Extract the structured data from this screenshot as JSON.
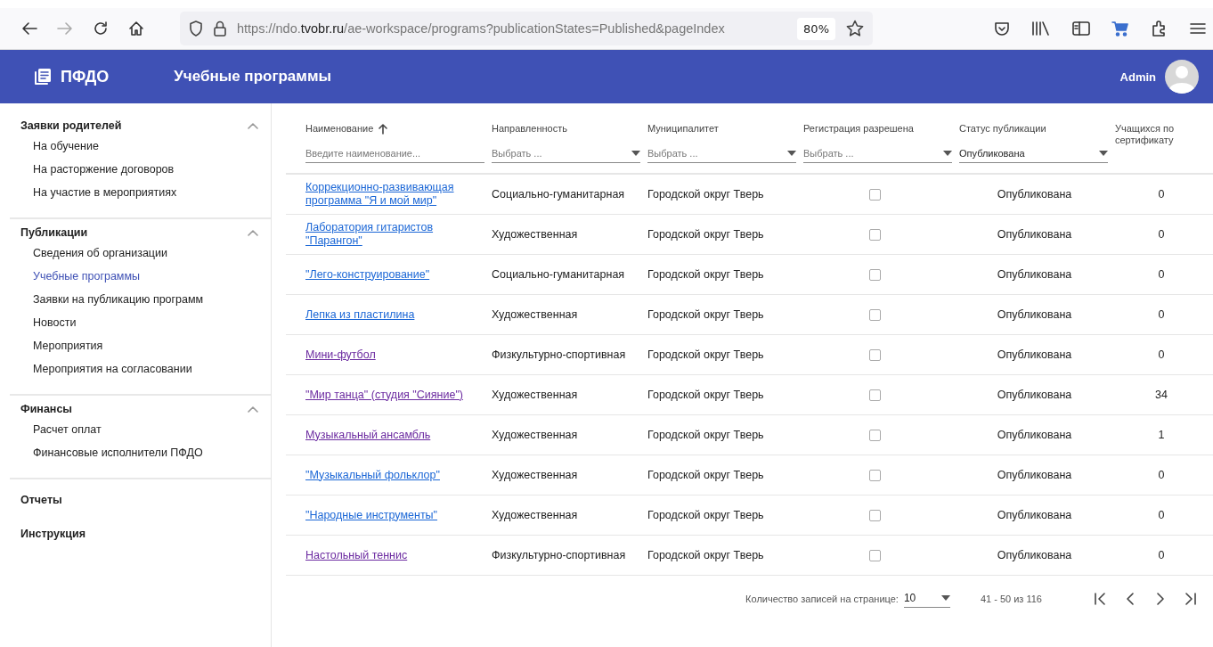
{
  "browser": {
    "back_disabled": false,
    "forward_disabled": true,
    "url": "https://ndo.**tvobr.ru**/ae-workspace/programs?publicationStates=Published&pageIndex",
    "zoom": "80%"
  },
  "header": {
    "logo": "ПФДО",
    "title": "Учебные программы",
    "user": "Admin"
  },
  "sidebar": {
    "groups": [
      {
        "title": "Заявки родителей",
        "expanded": true,
        "items": [
          {
            "label": "На обучение",
            "selected": false
          },
          {
            "label": "На расторжение договоров",
            "selected": false
          },
          {
            "label": "На участие в мероприятиях",
            "selected": false
          }
        ]
      },
      {
        "title": "Публикации",
        "expanded": true,
        "items": [
          {
            "label": "Сведения об организации",
            "selected": false
          },
          {
            "label": "Учебные программы",
            "selected": true
          },
          {
            "label": "Заявки на публикацию программ",
            "selected": false
          },
          {
            "label": "Новости",
            "selected": false
          },
          {
            "label": "Мероприятия",
            "selected": false
          },
          {
            "label": "Мероприятия на согласовании",
            "selected": false
          }
        ]
      },
      {
        "title": "Финансы",
        "expanded": true,
        "items": [
          {
            "label": "Расчет оплат",
            "selected": false
          },
          {
            "label": "Финансовые исполнители ПФДО",
            "selected": false
          }
        ]
      }
    ],
    "links": [
      "Отчеты",
      "Инструкция"
    ]
  },
  "table": {
    "columns": [
      {
        "label": "Наименование",
        "sorted": true,
        "filter": {
          "kind": "text",
          "placeholder": "Введите наименование..."
        }
      },
      {
        "label": "Направленность",
        "filter": {
          "kind": "select",
          "placeholder": "Выбрать ..."
        }
      },
      {
        "label": "Муниципалитет",
        "filter": {
          "kind": "select",
          "placeholder": "Выбрать ..."
        }
      },
      {
        "label": "Регистрация разрешена",
        "filter": {
          "kind": "select",
          "placeholder": "Выбрать ..."
        }
      },
      {
        "label": "Статус публикации",
        "filter": {
          "kind": "select",
          "value": "Опубликована"
        }
      },
      {
        "label": "Учащихся по сертификату"
      }
    ],
    "rows": [
      {
        "name": "Коррекционно-развивающая программа \"Я и мой мир\"",
        "visited": false,
        "direction": "Социально-гуманитарная",
        "municipality": "Городской округ Тверь",
        "registration_allowed": false,
        "status": "Опубликована",
        "students": "0"
      },
      {
        "name": "Лаборатория гитаристов \"Парангон\"",
        "visited": false,
        "direction": "Художественная",
        "municipality": "Городской округ Тверь",
        "registration_allowed": false,
        "status": "Опубликована",
        "students": "0"
      },
      {
        "name": "\"Лего-конструирование\"",
        "visited": false,
        "direction": "Социально-гуманитарная",
        "municipality": "Городской округ Тверь",
        "registration_allowed": false,
        "status": "Опубликована",
        "students": "0"
      },
      {
        "name": "Лепка из пластилина",
        "visited": false,
        "direction": "Художественная",
        "municipality": "Городской округ Тверь",
        "registration_allowed": false,
        "status": "Опубликована",
        "students": "0"
      },
      {
        "name": "Мини-футбол",
        "visited": true,
        "direction": "Физкультурно-спортивная",
        "municipality": "Городской округ Тверь",
        "registration_allowed": false,
        "status": "Опубликована",
        "students": "0"
      },
      {
        "name": "\"Мир танца\" (студия \"Сияние\")",
        "visited": true,
        "direction": "Художественная",
        "municipality": "Городской округ Тверь",
        "registration_allowed": false,
        "status": "Опубликована",
        "students": "34"
      },
      {
        "name": "Музыкальный ансамбль",
        "visited": true,
        "direction": "Художественная",
        "municipality": "Городской округ Тверь",
        "registration_allowed": false,
        "status": "Опубликована",
        "students": "1"
      },
      {
        "name": "\"Музыкальный фольклор\"",
        "visited": false,
        "direction": "Художественная",
        "municipality": "Городской округ Тверь",
        "registration_allowed": false,
        "status": "Опубликована",
        "students": "0"
      },
      {
        "name": "\"Народные инструменты\"",
        "visited": false,
        "direction": "Художественная",
        "municipality": "Городской округ Тверь",
        "registration_allowed": false,
        "status": "Опубликована",
        "students": "0"
      },
      {
        "name": "Настольный теннис",
        "visited": true,
        "direction": "Физкультурно-спортивная",
        "municipality": "Городской округ Тверь",
        "registration_allowed": false,
        "status": "Опубликована",
        "students": "0"
      }
    ]
  },
  "pagination": {
    "page_size_label": "Количество записей на странице:",
    "page_size": "10",
    "range": "41 - 50 из 116",
    "first_disabled": false,
    "prev_disabled": false,
    "next_disabled": false,
    "last_disabled": false
  }
}
